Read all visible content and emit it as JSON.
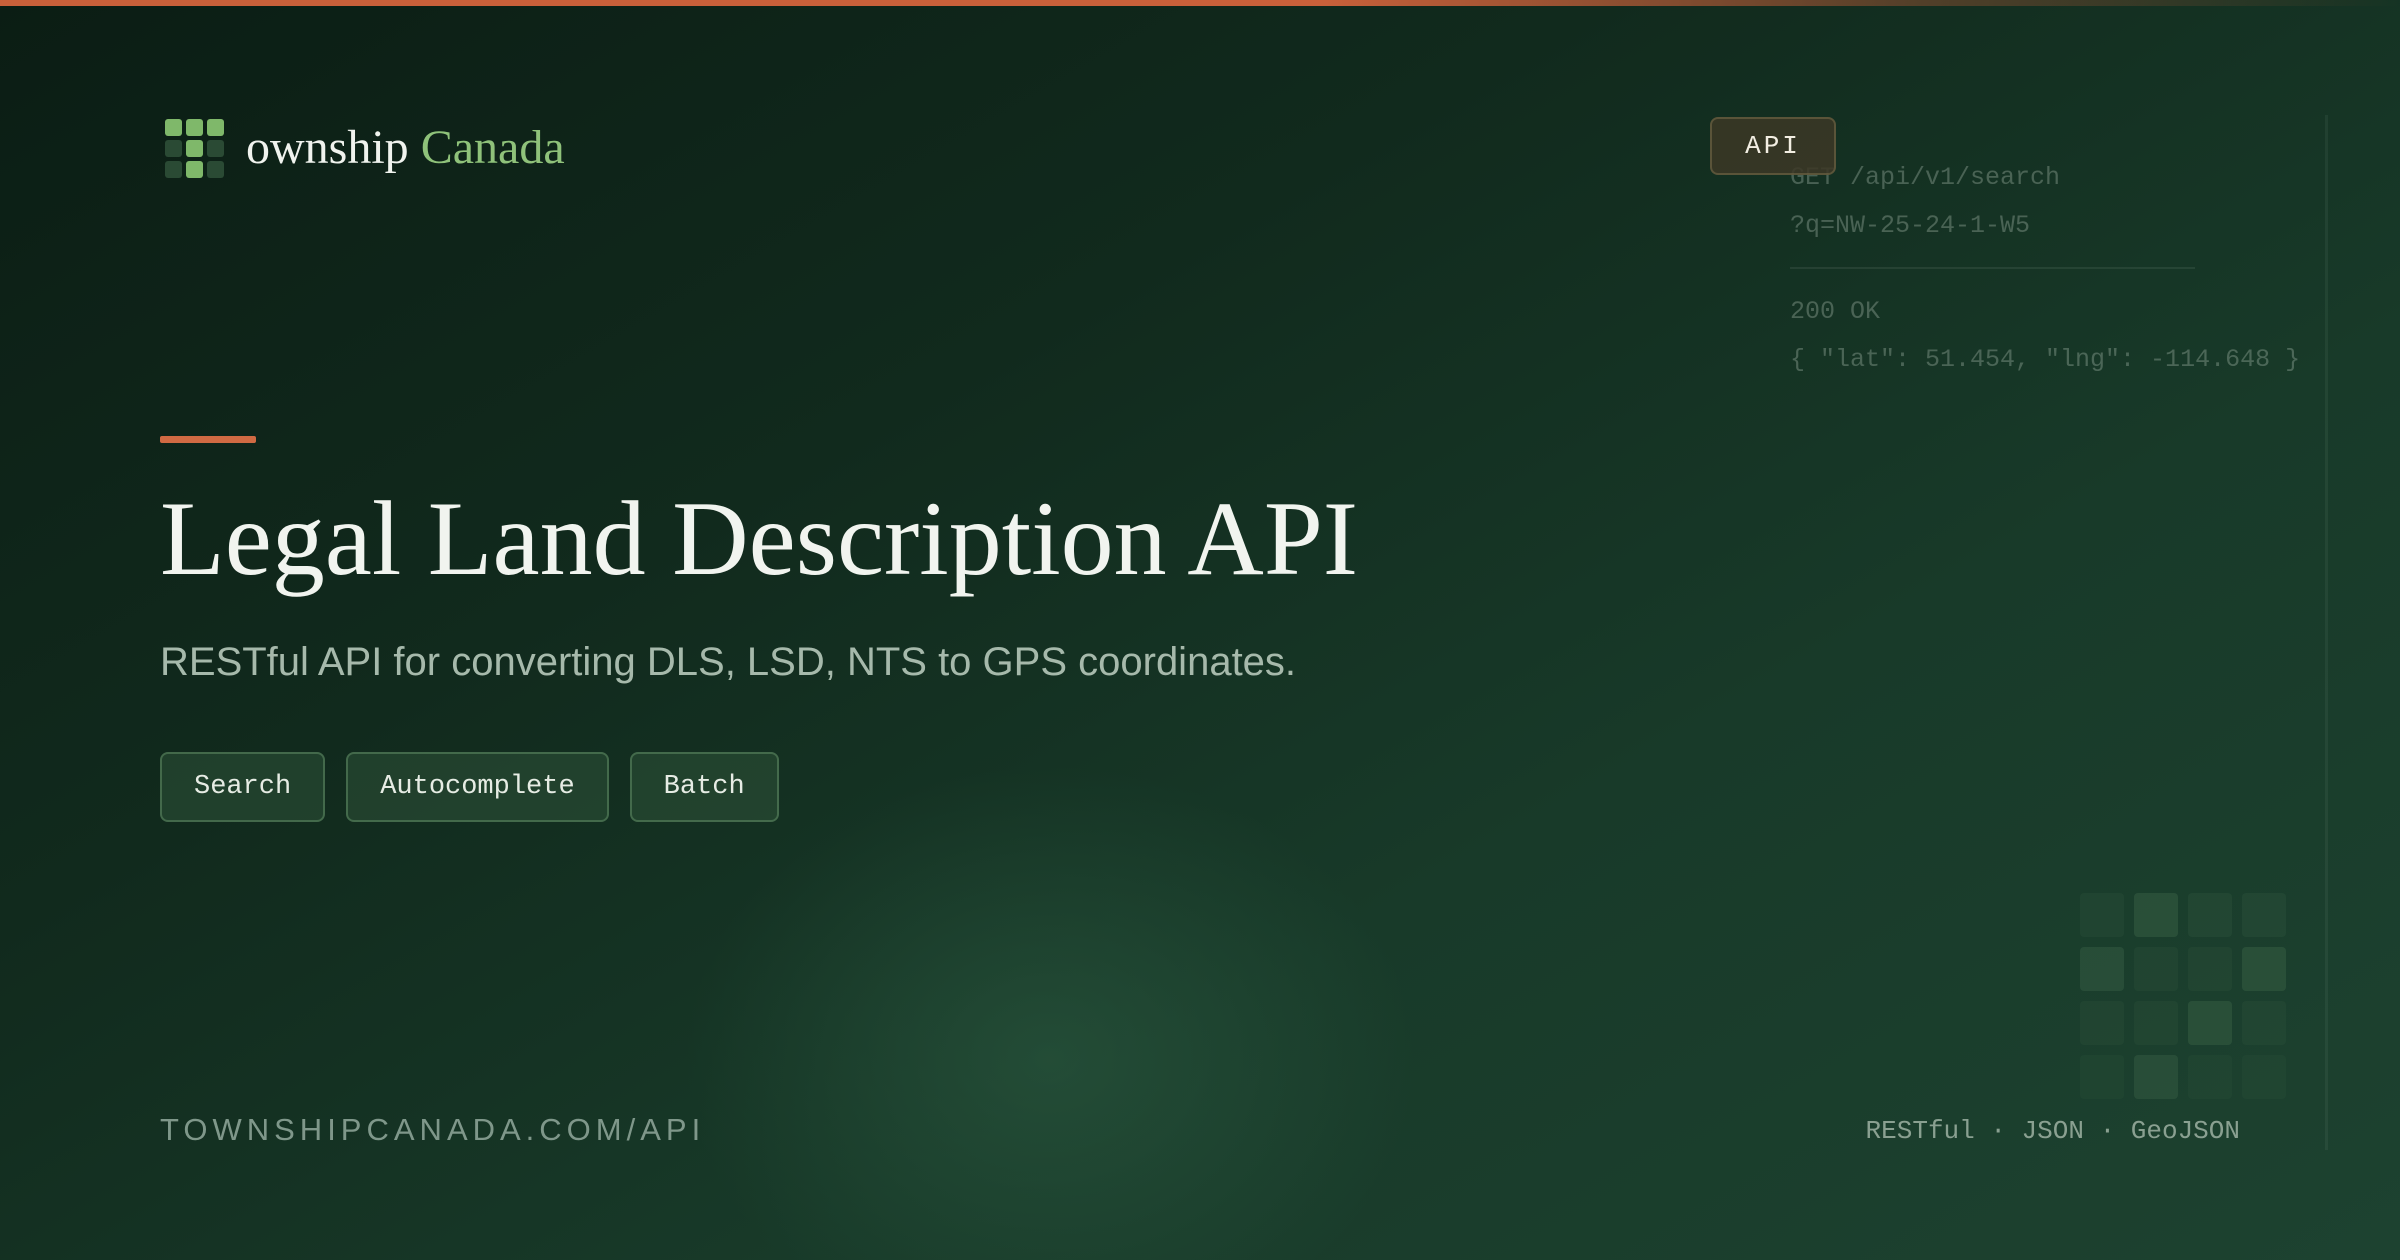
{
  "brand": {
    "name_part_1": "ownship",
    "name_part_2": "Canada",
    "logo_icon": "grid-logo-icon",
    "accent_color": "#c9603a",
    "green_color": "#8fc27a"
  },
  "code_card": {
    "badge": "API",
    "request_line_1": "GET /api/v1/search",
    "request_line_2": "?q=NW-25-24-1-W5",
    "status": "200 OK",
    "response": "{ \"lat\": 51.454, \"lng\": -114.648 }"
  },
  "hero": {
    "title": "Legal Land Description API",
    "subtitle": "RESTful API for converting DLS, LSD, NTS to GPS coordinates.",
    "chips": [
      {
        "label": "Search"
      },
      {
        "label": "Autocomplete"
      },
      {
        "label": "Batch"
      }
    ]
  },
  "footer": {
    "url": "TOWNSHIPCANADA.COM/API",
    "tags": "RESTful · JSON · GeoJSON"
  }
}
